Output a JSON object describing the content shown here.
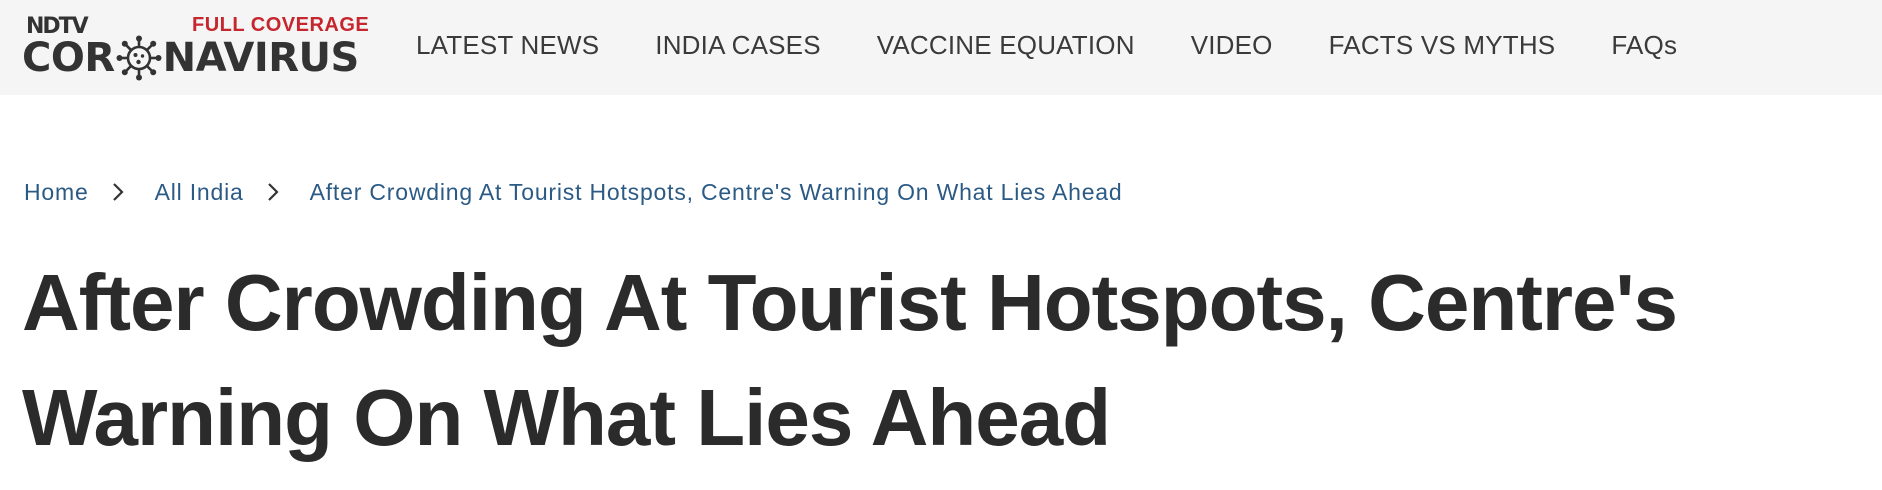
{
  "header": {
    "logo": {
      "brand": "NDTV",
      "tag": "FULL COVERAGE",
      "word_left": "COR",
      "word_right": "NAVIRUS",
      "icon": "coronavirus-icon"
    },
    "nav": [
      {
        "label": "LATEST NEWS"
      },
      {
        "label": "INDIA CASES"
      },
      {
        "label": "VACCINE EQUATION"
      },
      {
        "label": "VIDEO"
      },
      {
        "label": "FACTS VS MYTHS"
      },
      {
        "label": "FAQs"
      }
    ]
  },
  "breadcrumb": {
    "items": [
      {
        "label": "Home"
      },
      {
        "label": "All India"
      },
      {
        "label": "After Crowding At Tourist Hotspots, Centre's Warning On What Lies Ahead"
      }
    ],
    "separator_icon": "chevron-right-icon"
  },
  "article": {
    "headline": "After Crowding At Tourist Hotspots, Centre's Warning On What Lies Ahead"
  },
  "colors": {
    "topbar_bg": "#f5f5f5",
    "accent_red": "#c6262e",
    "link_blue": "#2b5a85",
    "text_dark": "#2b2b2b"
  }
}
